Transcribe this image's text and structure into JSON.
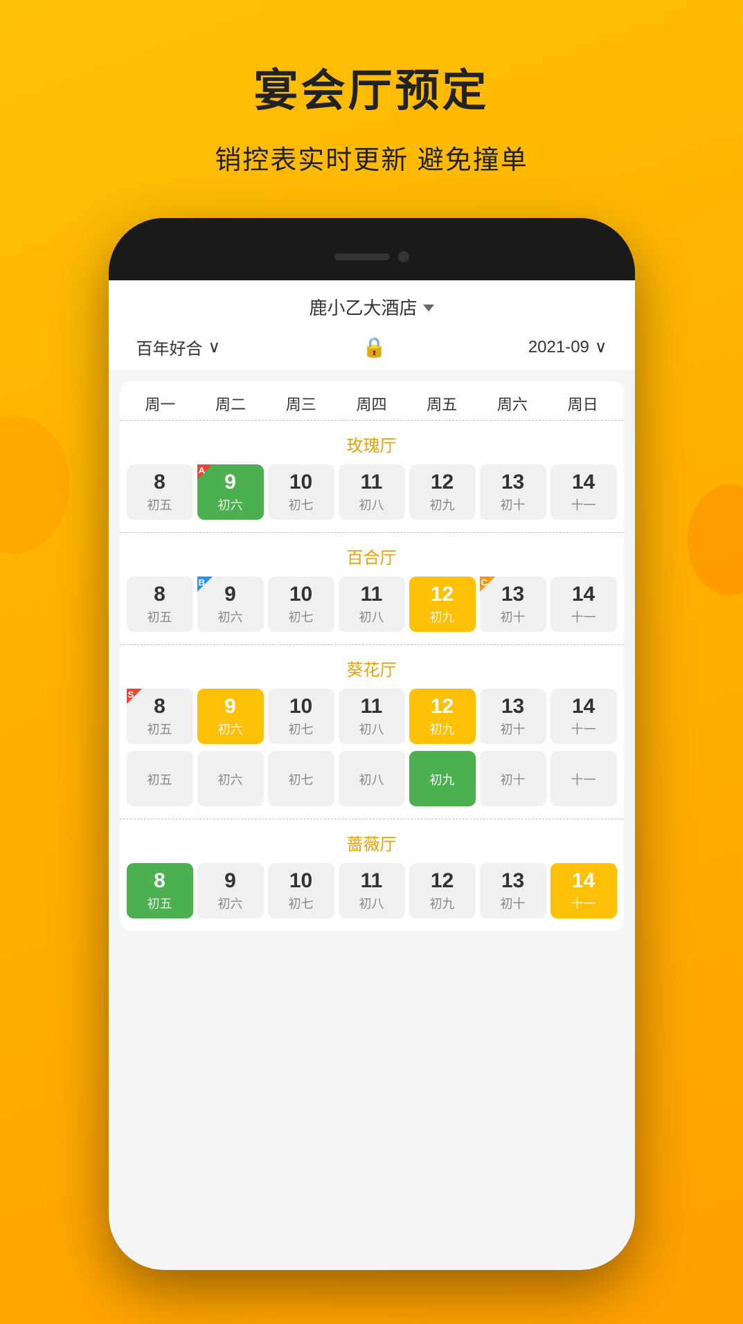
{
  "app": {
    "title": "宴会厅预定",
    "subtitle": "销控表实时更新  避免撞单"
  },
  "header": {
    "hotel_name": "鹿小乙大酒店",
    "dropdown_symbol": "▼",
    "hall_filter": "百年好合",
    "hall_filter_arrow": "∨",
    "lock_label": "🔒",
    "date": "2021-09",
    "date_arrow": "∨"
  },
  "days": {
    "headers": [
      "周一",
      "周二",
      "周三",
      "周四",
      "周五",
      "周六",
      "周日"
    ]
  },
  "halls": [
    {
      "name": "玫瑰厅",
      "dates": [
        {
          "num": "8",
          "lunar": "初五",
          "style": "normal",
          "badge": null
        },
        {
          "num": "9",
          "lunar": "初六",
          "style": "green",
          "badge": "A"
        },
        {
          "num": "10",
          "lunar": "初七",
          "style": "normal",
          "badge": null
        },
        {
          "num": "11",
          "lunar": "初八",
          "style": "normal",
          "badge": null
        },
        {
          "num": "12",
          "lunar": "初九",
          "style": "normal",
          "badge": null
        },
        {
          "num": "13",
          "lunar": "初十",
          "style": "normal",
          "badge": null
        },
        {
          "num": "14",
          "lunar": "十一",
          "style": "normal",
          "badge": null
        }
      ]
    },
    {
      "name": "百合厅",
      "dates": [
        {
          "num": "8",
          "lunar": "初五",
          "style": "normal",
          "badge": null
        },
        {
          "num": "9",
          "lunar": "初六",
          "style": "normal",
          "badge": "B"
        },
        {
          "num": "10",
          "lunar": "初七",
          "style": "normal",
          "badge": null
        },
        {
          "num": "11",
          "lunar": "初八",
          "style": "normal",
          "badge": null
        },
        {
          "num": "12",
          "lunar": "初九",
          "style": "yellow",
          "badge": null
        },
        {
          "num": "13",
          "lunar": "初十",
          "style": "normal",
          "badge": "C"
        },
        {
          "num": "14",
          "lunar": "十一",
          "style": "normal",
          "badge": null
        }
      ]
    },
    {
      "name": "葵花厅",
      "dates": [
        {
          "num": "8",
          "lunar": "初五",
          "style": "normal",
          "badge": "S"
        },
        {
          "num": "9",
          "lunar": "初六",
          "style": "yellow",
          "badge": null
        },
        {
          "num": "10",
          "lunar": "初七",
          "style": "normal",
          "badge": null
        },
        {
          "num": "11",
          "lunar": "初八",
          "style": "normal",
          "badge": null
        },
        {
          "num": "12",
          "lunar": "初九",
          "style": "yellow",
          "badge": null
        },
        {
          "num": "13",
          "lunar": "初十",
          "style": "normal",
          "badge": null
        },
        {
          "num": "14",
          "lunar": "十一",
          "style": "normal",
          "badge": null
        }
      ],
      "lunar_override": [
        "初五",
        "初六",
        "初七",
        "初八",
        "初九(green)",
        "初十",
        "十一"
      ]
    },
    {
      "name": "蔷薇厅",
      "dates": [
        {
          "num": "8",
          "lunar": "初五",
          "style": "green",
          "badge": null
        },
        {
          "num": "9",
          "lunar": "初六",
          "style": "normal",
          "badge": null
        },
        {
          "num": "10",
          "lunar": "初七",
          "style": "normal",
          "badge": null
        },
        {
          "num": "11",
          "lunar": "初八",
          "style": "normal",
          "badge": null
        },
        {
          "num": "12",
          "lunar": "初九",
          "style": "normal",
          "badge": null
        },
        {
          "num": "13",
          "lunar": "初十",
          "style": "normal",
          "badge": null
        },
        {
          "num": "14",
          "lunar": "十一",
          "style": "yellow",
          "badge": null
        }
      ]
    }
  ]
}
